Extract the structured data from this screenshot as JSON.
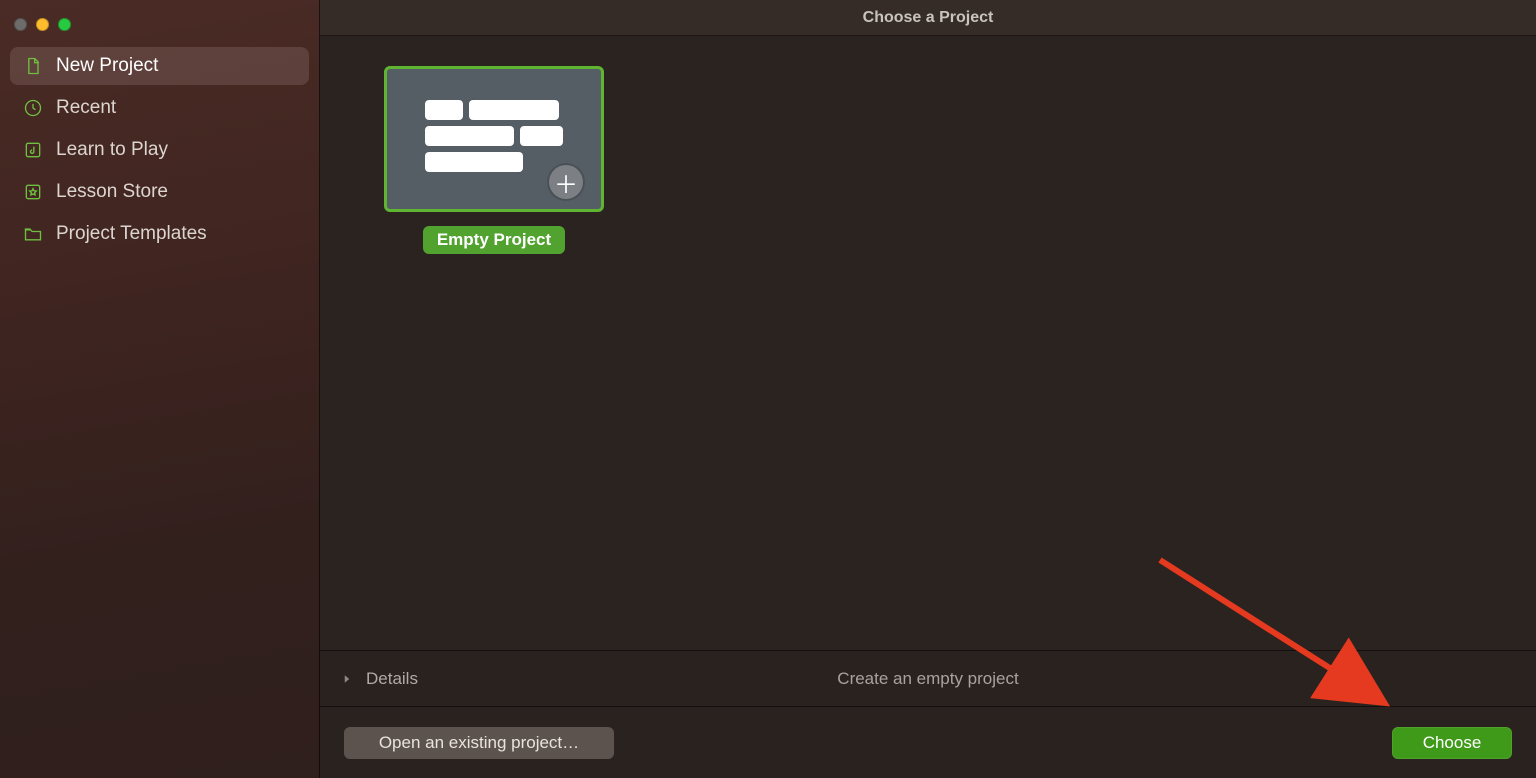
{
  "window": {
    "title": "Choose a Project"
  },
  "sidebar": {
    "items": [
      {
        "label": "New Project",
        "icon": "document-icon",
        "selected": true
      },
      {
        "label": "Recent",
        "icon": "clock-icon",
        "selected": false
      },
      {
        "label": "Learn to Play",
        "icon": "music-note-icon",
        "selected": false
      },
      {
        "label": "Lesson Store",
        "icon": "star-box-icon",
        "selected": false
      },
      {
        "label": "Project Templates",
        "icon": "folder-icon",
        "selected": false
      }
    ]
  },
  "templates": [
    {
      "label": "Empty Project",
      "selected": true
    }
  ],
  "details": {
    "header": "Details",
    "description": "Create an empty project"
  },
  "footer": {
    "open_existing": "Open an existing project…",
    "choose": "Choose"
  },
  "colors": {
    "accent": "#5fb531",
    "sidebar_icon": "#6fbf41"
  }
}
